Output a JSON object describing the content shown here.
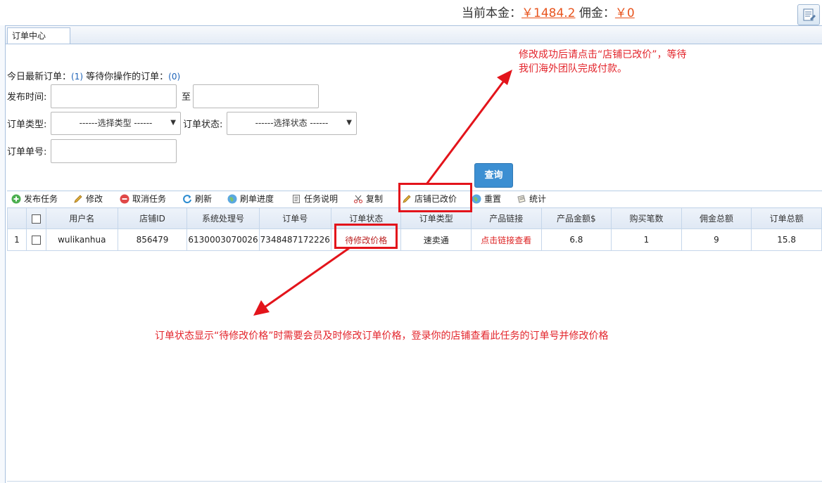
{
  "header": {
    "principal_label": "当前本金：",
    "principal_value": "￥1484.2",
    "commission_label": "佣金：",
    "commission_value": "￥0"
  },
  "tabs": [
    {
      "label": "订单中心"
    }
  ],
  "summary": {
    "today_label": "今日最新订单：",
    "today_count": "(1)",
    "pending_label": "等待你操作的订单：",
    "pending_count": "(0)"
  },
  "filters": {
    "publish_time_label": "发布时间:",
    "to_label": "至",
    "order_type_label": "订单类型:",
    "order_type_value": "------选择类型 ------",
    "order_status_label": "订单状态:",
    "order_status_value": "------选择状态 ------",
    "order_no_label": "订单单号:",
    "query_button": "查询"
  },
  "toolbar": {
    "publish": "发布任务",
    "edit": "修改",
    "cancel": "取消任务",
    "refresh": "刷新",
    "progress": "刷单进度",
    "task_desc": "任务说明",
    "copy": "复制",
    "price_changed": "店铺已改价",
    "reset": "重置",
    "stats": "统计"
  },
  "grid": {
    "columns": [
      "用户名",
      "店铺ID",
      "系统处理号",
      "订单号",
      "订单状态",
      "订单类型",
      "产品链接",
      "产品金额$",
      "购买笔数",
      "佣金总额",
      "订单总额"
    ],
    "rows": [
      {
        "index": "1",
        "cells": [
          "wulikanhua",
          "856479",
          "6130003070026",
          "7348487172226",
          "待修改价格",
          "速卖通",
          "点击链接查看",
          "6.8",
          "1",
          "9",
          "15.8"
        ]
      }
    ]
  },
  "annotations": {
    "top_note_line1": "修改成功后请点击“店铺已改价”，等待",
    "top_note_line2": "我们海外团队完成付款。",
    "bottom_note": "订单状态显示“待修改价格”时需要会员及时修改订单价格，登录你的店铺查看此任务的订单号并修改价格",
    "color": "#e3141b"
  }
}
